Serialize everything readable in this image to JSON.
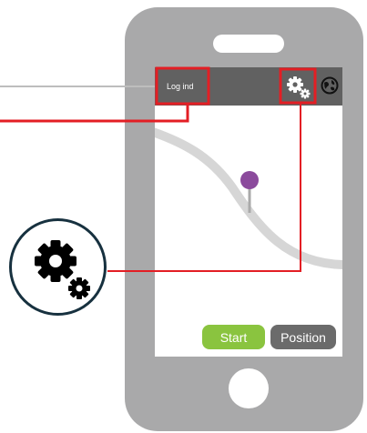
{
  "app_bar": {
    "login_label": "Log ind",
    "settings_icon": "gears-icon",
    "globe_icon": "globe-icon"
  },
  "map": {
    "marker_color": "#8b4a9c"
  },
  "buttons": {
    "start_label": "Start",
    "position_label": "Position"
  },
  "colors": {
    "phone": "#a9a9aa",
    "app_bar": "#616161",
    "highlight": "#e31e24",
    "start": "#8ac43f",
    "position": "#6b6b6b",
    "zoom_border": "#17313f"
  }
}
